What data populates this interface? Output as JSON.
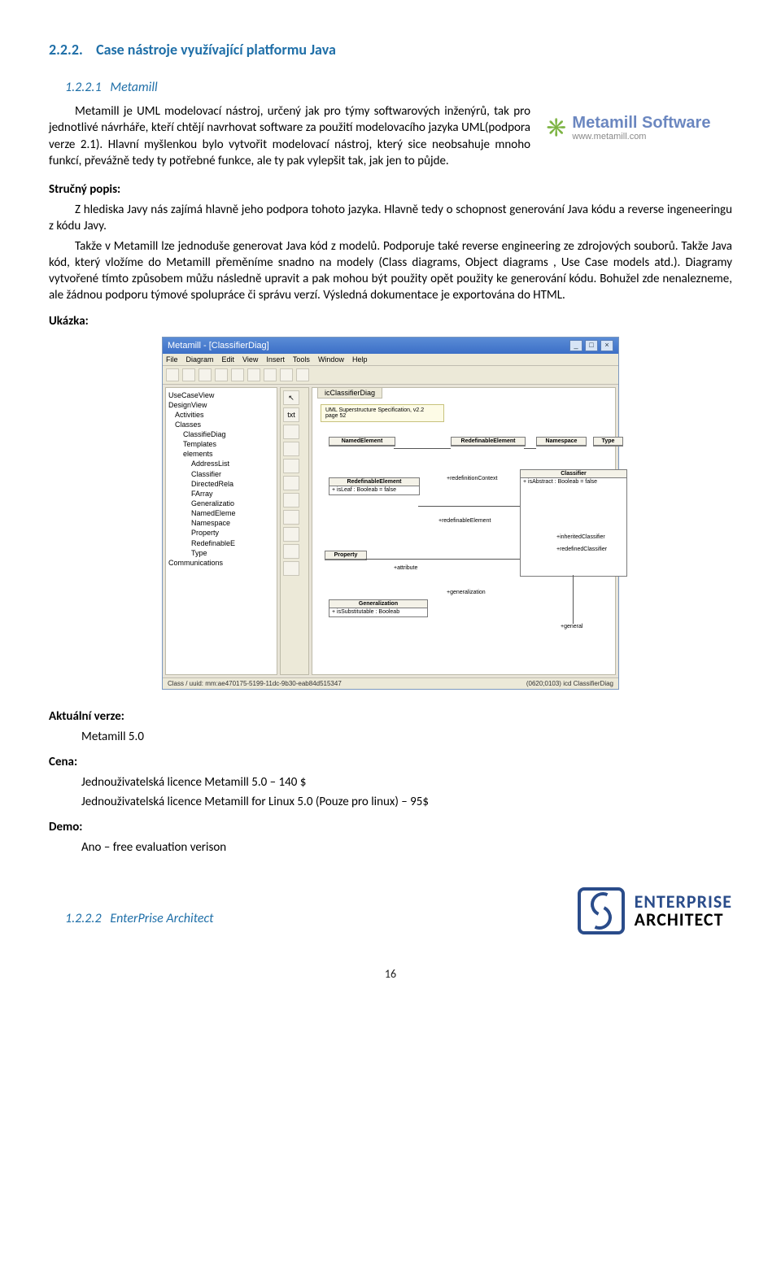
{
  "section": {
    "h2_num": "2.2.2.",
    "h2_title": "Case nástroje využívající platformu Java",
    "h3_num": "1.2.2.1",
    "h3_title": "Metamill",
    "h3b_num": "1.2.2.2",
    "h3b_title": "EnterPrise Architect"
  },
  "logo": {
    "metamill_name": "Metamill Software",
    "metamill_url": "www.metamill.com",
    "ea_line1": "ENTERPRISE",
    "ea_line2": "ARCHITECT"
  },
  "text": {
    "p1": "Metamill je UML modelovací nástroj, určený jak pro týmy softwarových inženýrů, tak pro jednotlivé návrháře, kteří chtějí navrhovat software za použití modelovacího jazyka UML(podpora verze 2.1). Hlavní myšlenkou bylo vytvořit modelovací nástroj, který sice neobsahuje mnoho funkcí, převážně tedy ty potřebné funkce, ale ty pak vylepšit tak, jak jen to půjde.",
    "subhead1": "Stručný popis:",
    "p2": "Z hlediska Javy nás zajímá hlavně jeho podpora tohoto jazyka. Hlavně tedy o schopnost generování Java kódu a reverse ingeneeringu z kódu Javy.",
    "p3": "Takže v Metamill lze jednoduše  generovat Java kód z modelů. Podporuje také reverse engineering ze zdrojových souborů. Takže Java kód, který vložíme do Metamill přeměníme snadno na modely (Class diagrams, Object diagrams , Use Case models atd.). Diagramy vytvořené tímto způsobem můžu následně upravit a pak mohou být použity opět použity ke generování kódu. Bohužel zde nenalezneme, ale žádnou podporu týmové spolupráce či správu verzí. Výsledná dokumentace je exportována do HTML.",
    "subhead2": "Ukázka:",
    "subhead3": "Aktuální verze:",
    "version": "Metamill 5.0",
    "subhead4": "Cena:",
    "price1": "Jednouživatelská licence Metamill 5.0 – 140 $",
    "price2": "Jednouživatelská licence Metamill for Linux 5.0 (Pouze pro linux) – 95$",
    "subhead5": "Demo:",
    "demo": "Ano – free evaluation verison"
  },
  "app": {
    "title": "Metamill - [ClassifierDiag]",
    "menu": [
      "File",
      "Diagram",
      "Edit",
      "View",
      "Insert",
      "Tools",
      "Window",
      "Help"
    ],
    "tree": [
      {
        "l": 0,
        "t": "UseCaseView"
      },
      {
        "l": 0,
        "t": "DesignView"
      },
      {
        "l": 1,
        "t": "Activities"
      },
      {
        "l": 1,
        "t": "Classes"
      },
      {
        "l": 2,
        "t": "ClassifieDiag"
      },
      {
        "l": 2,
        "t": "Templates"
      },
      {
        "l": 2,
        "t": "elements"
      },
      {
        "l": 3,
        "t": "AddressList"
      },
      {
        "l": 3,
        "t": "Classifier"
      },
      {
        "l": 3,
        "t": "DirectedRela"
      },
      {
        "l": 3,
        "t": "FArray"
      },
      {
        "l": 3,
        "t": "Generalizatio"
      },
      {
        "l": 3,
        "t": "NamedEleme"
      },
      {
        "l": 3,
        "t": "Namespace"
      },
      {
        "l": 3,
        "t": "Property"
      },
      {
        "l": 3,
        "t": "RedefinableE"
      },
      {
        "l": 3,
        "t": "Type"
      },
      {
        "l": 0,
        "t": "Communications"
      }
    ],
    "tab": "icClassifierDiag",
    "status_left": "Class / uuid: mm:ae470175-5199-11dc-9b30-eab84d515347",
    "status_right": "(0620;0103)  icd ClassifierDiag",
    "note_title": "UML Superstructure Specification, v2.2",
    "note_sub": "page 52",
    "box1": "NamedElement",
    "box2": "RedefinableElement",
    "box2_attr": "+ isLeaf : Booleab = false",
    "box3": "Namespace",
    "box4": "Type",
    "box5": "Classifier",
    "box5_attr": "+ isAbstract : Booleab = false",
    "box6": "Property",
    "box7": "Generalization",
    "box7_attr": "+ isSubstitutable : Booleab",
    "assoc1": "+redefinitionContext",
    "assoc2": "+redefinableElement",
    "assoc3": "+generalization",
    "assoc4": "+redefinedClassifier",
    "assoc5": "+general",
    "assoc6": "+attribute",
    "assoc7": "+inheritedClassifier"
  },
  "page": "16"
}
